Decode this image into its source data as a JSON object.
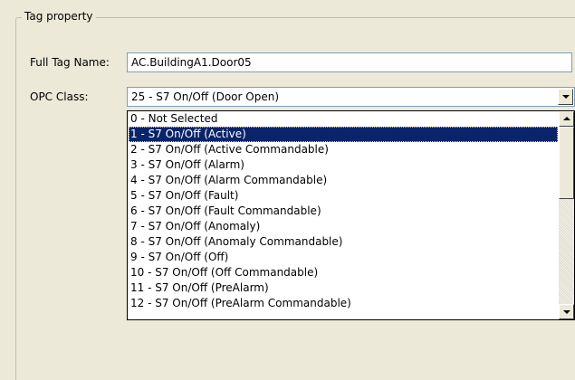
{
  "group": {
    "title": "Tag property"
  },
  "fields": {
    "full_tag_name": {
      "label": "Full Tag Name:",
      "value": "AC.BuildingA1.Door05"
    },
    "opc_class": {
      "label": "OPC Class:",
      "value": "25 - S7 On/Off (Door Open)"
    }
  },
  "dropdown": {
    "selected_index": 1,
    "options": [
      "0 - Not Selected",
      "1 - S7 On/Off (Active)",
      "2 - S7 On/Off (Active Commandable)",
      "3 - S7 On/Off (Alarm)",
      "4 - S7 On/Off (Alarm Commandable)",
      "5 - S7 On/Off (Fault)",
      "6 - S7 On/Off (Fault Commandable)",
      "7 - S7 On/Off (Anomaly)",
      "8 - S7 On/Off (Anomaly Commandable)",
      "9 - S7 On/Off (Off)",
      "10 - S7 On/Off (Off Commandable)",
      "11 - S7 On/Off (PreAlarm)",
      "12 - S7 On/Off (PreAlarm Commandable)"
    ]
  },
  "colors": {
    "selection": "#0a246a",
    "border": "#7f9db9",
    "background": "#ece9d8"
  }
}
